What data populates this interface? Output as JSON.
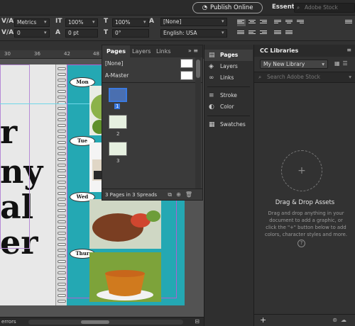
{
  "appbar": {
    "publish_label": "Publish Online",
    "workspace_label": "Essentials",
    "workspace_caret": "▾",
    "stock_placeholder": "Adobe Stock"
  },
  "control": {
    "font_style": "Metrics",
    "tracking": "0",
    "vscale": "100%",
    "hscale": "100%",
    "baseline": "0 pt",
    "skew": "0°",
    "char_style": "[None]",
    "language": "English: USA"
  },
  "ruler": {
    "ticks": [
      "30",
      "36",
      "42",
      "48"
    ]
  },
  "document": {
    "big_letters": [
      "r",
      "ny",
      "al",
      "er"
    ],
    "days": [
      "Mon",
      "Tue",
      "Wed",
      "Thur"
    ]
  },
  "pages_panel": {
    "tabs": [
      "Pages",
      "Layers",
      "Links"
    ],
    "menu_icons": "»  ≡",
    "masters": [
      "[None]",
      "A-Master"
    ],
    "pages": [
      "1",
      "2",
      "3"
    ],
    "footer": "3 Pages in 3 Spreads"
  },
  "dock": {
    "items": [
      "Pages",
      "Layers",
      "Links",
      "Stroke",
      "Color",
      "Swatches"
    ]
  },
  "cclib": {
    "title": "CC Libraries",
    "library": "My New Library",
    "search_placeholder": "Search Adobe Stock",
    "heading": "Drag & Drop Assets",
    "body": "Drag and drop anything in your document to add a graphic, or click the \"+\" button below to add colors, character styles and more."
  },
  "status": {
    "errors": "errors"
  },
  "colors": {
    "accent": "#3b7ae0",
    "teal": "#24a8b3"
  }
}
